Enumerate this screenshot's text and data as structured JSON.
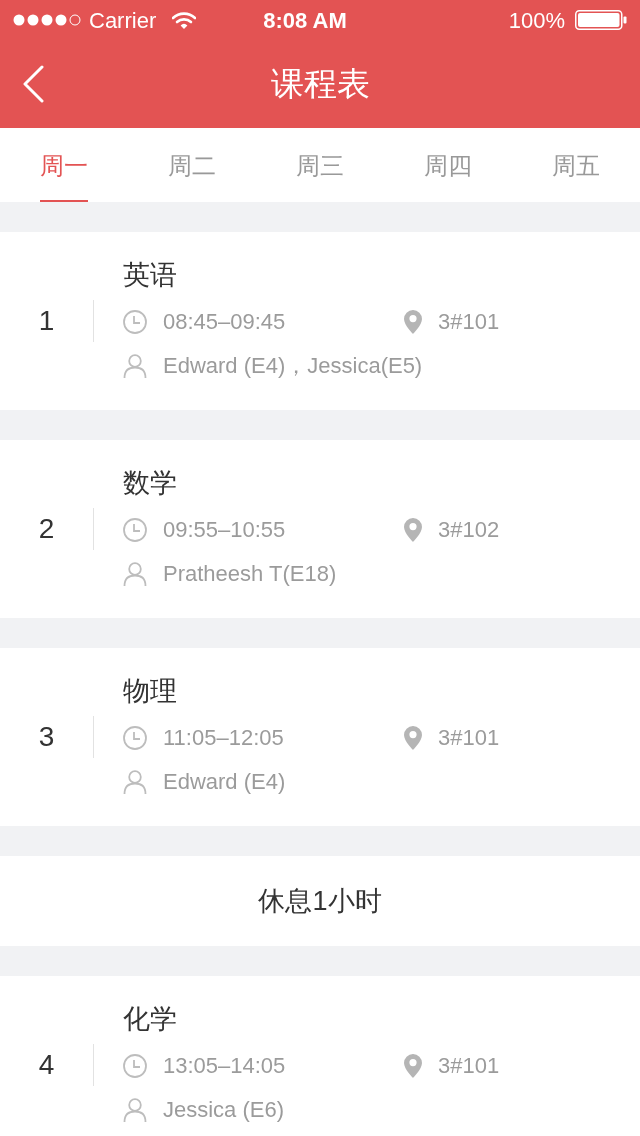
{
  "status_bar": {
    "carrier": "Carrier",
    "time": "8:08 AM",
    "battery": "100%"
  },
  "nav_bar": {
    "title": "课程表"
  },
  "tabs": [
    {
      "label": "周一",
      "selected": true
    },
    {
      "label": "周二",
      "selected": false
    },
    {
      "label": "周三",
      "selected": false
    },
    {
      "label": "周四",
      "selected": false
    },
    {
      "label": "周五",
      "selected": false
    }
  ],
  "schedule": [
    {
      "kind": "lesson",
      "number": "1",
      "subject": "英语",
      "time": "08:45–09:45",
      "room": "3#101",
      "teachers": "Edward (E4)，Jessica(E5)"
    },
    {
      "kind": "lesson",
      "number": "2",
      "subject": "数学",
      "time": "09:55–10:55",
      "room": "3#102",
      "teachers": "Pratheesh T(E18)"
    },
    {
      "kind": "lesson",
      "number": "3",
      "subject": "物理",
      "time": "11:05–12:05",
      "room": "3#101",
      "teachers": "Edward (E4)"
    },
    {
      "kind": "break",
      "label": "休息1小时"
    },
    {
      "kind": "lesson",
      "number": "4",
      "subject": "化学",
      "time": "13:05–14:05",
      "room": "3#101",
      "teachers": "Jessica (E6)"
    }
  ]
}
